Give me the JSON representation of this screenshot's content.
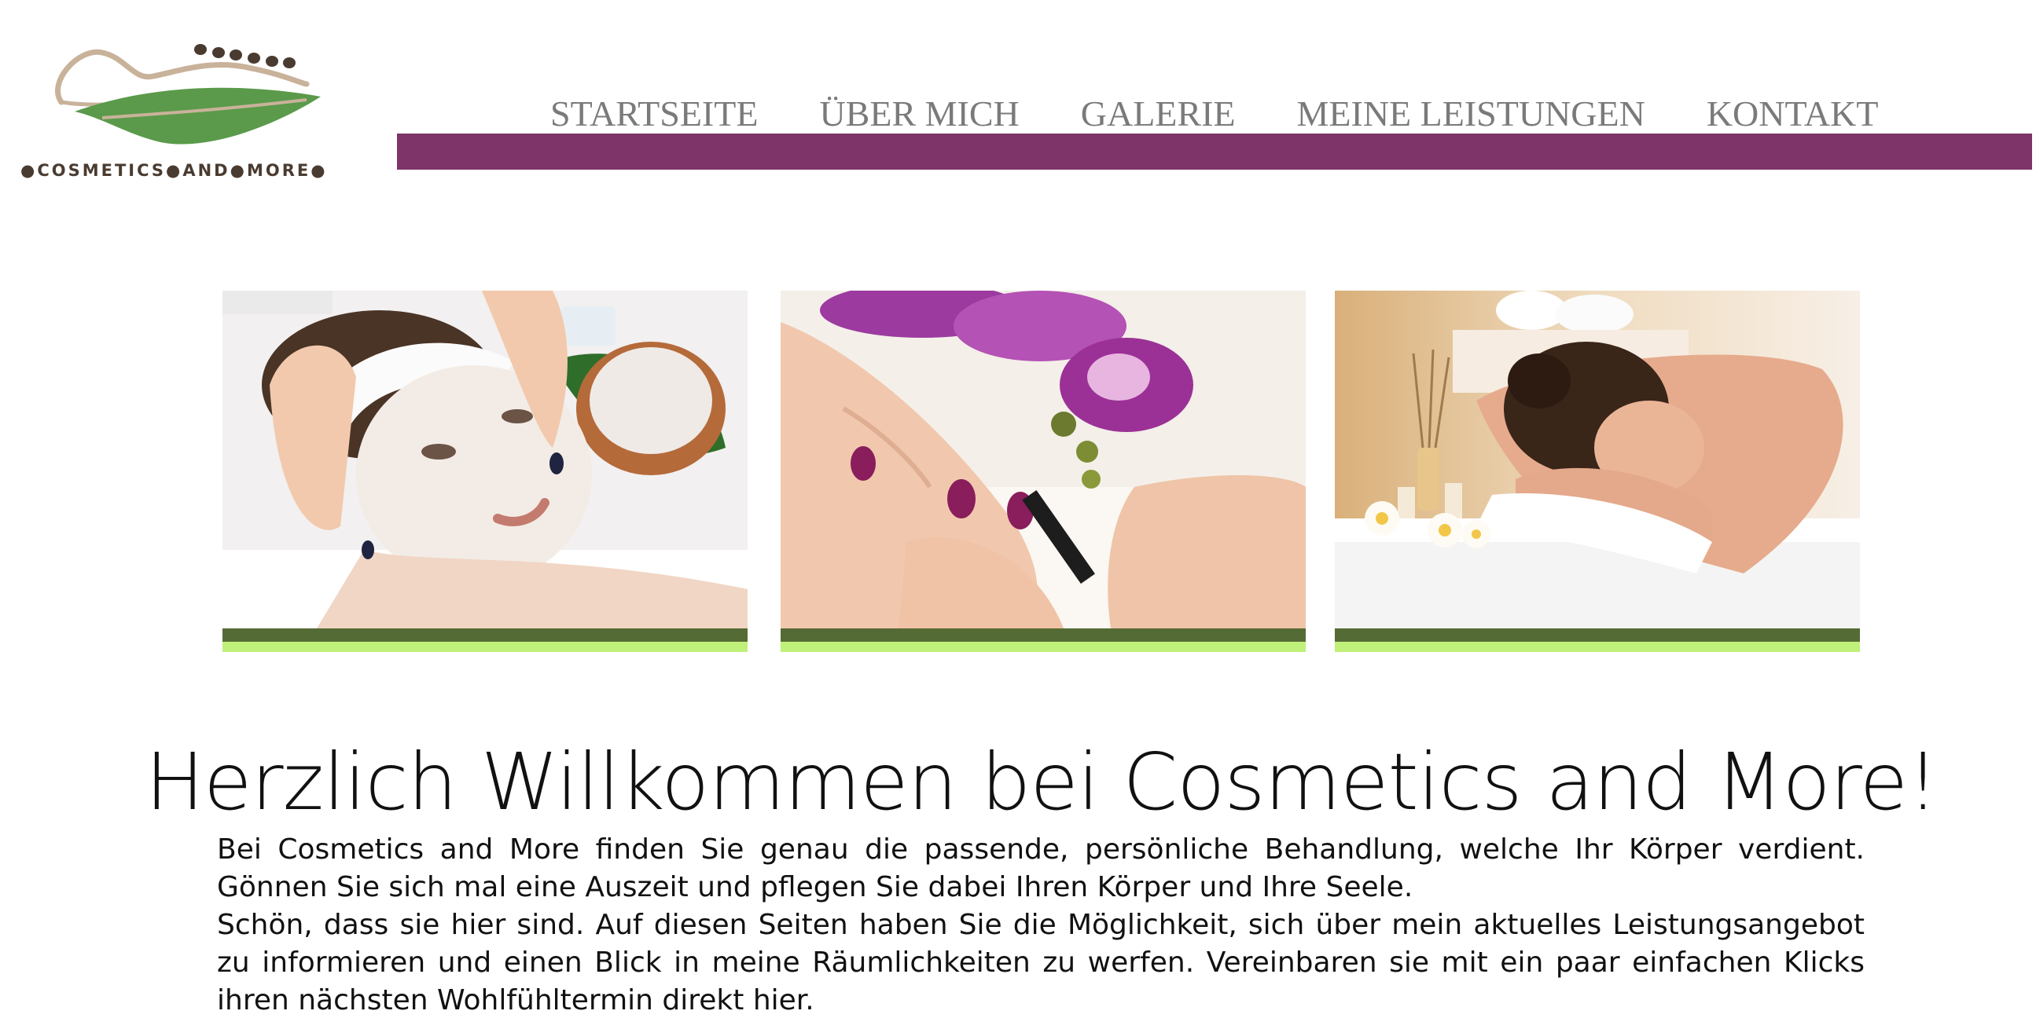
{
  "brand": {
    "logo_text_parts": [
      "COSMETICS",
      "AND",
      "MORE"
    ],
    "logo_colors": {
      "leaf": "#5a9a4a",
      "swoosh": "#c9b29a",
      "stones": "#4a3b30"
    }
  },
  "nav": {
    "items": [
      {
        "label": "STARTSEITE"
      },
      {
        "label": "ÜBER MICH"
      },
      {
        "label": "GALERIE"
      },
      {
        "label": "MEINE LEISTUNGEN"
      },
      {
        "label": "KONTAKT"
      }
    ],
    "bar_color": "#7e3468"
  },
  "gallery": {
    "images": [
      {
        "subject": "facial-mask-treatment"
      },
      {
        "subject": "manicure-nail-polish"
      },
      {
        "subject": "spa-massage-relaxation"
      }
    ],
    "stripe_colors": {
      "dark": "#556b35",
      "light": "#bff07a"
    }
  },
  "main": {
    "headline": "Herzlich Willkommen bei Cosmetics and More!",
    "paragraphs": [
      "Bei Cosmetics and More finden Sie genau die passende, persönliche Behandlung, welche Ihr Körper verdient. Gönnen Sie sich mal eine Auszeit und pflegen Sie dabei Ihren Körper und Ihre Seele.",
      "Schön, dass sie hier sind. Auf diesen Seiten haben Sie die Möglichkeit, sich über mein aktuelles Leistungsangebot zu informieren und einen Blick in meine Räumlichkeiten zu werfen. Vereinbaren sie mit ein paar einfachen Klicks ihren nächsten Wohlfühltermin direkt hier."
    ]
  }
}
